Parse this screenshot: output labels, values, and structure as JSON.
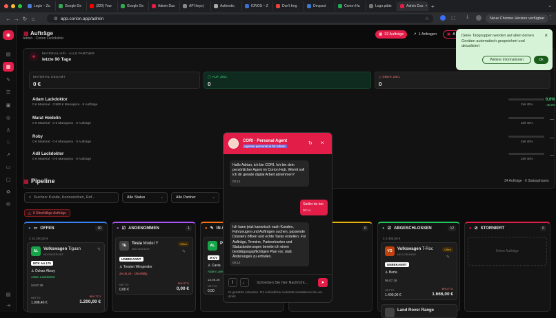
{
  "browser": {
    "tabs": [
      {
        "label": "Login – Zu",
        "color": "#4a7bd6"
      },
      {
        "label": "Google Ge",
        "color": "#34a853"
      },
      {
        "label": "(320) Your",
        "color": "#ff0000"
      },
      {
        "label": "Google Ge",
        "color": "#34a853"
      },
      {
        "label": "Admin Das",
        "color": "#e11d48"
      },
      {
        "label": "API keys |",
        "color": "#888888"
      },
      {
        "label": "Authentic",
        "color": "#aaaaaa"
      },
      {
        "label": "IONOS – Z",
        "color": "#3d6fd6"
      },
      {
        "label": "Don't forg",
        "color": "#ea4335"
      },
      {
        "label": "Devpost",
        "color": "#3a7bd5"
      },
      {
        "label": "Corion Hu",
        "color": "#22aa55"
      },
      {
        "label": "Logo pätte",
        "color": "#777777"
      },
      {
        "label": "Admin Das",
        "color": "#e11d48"
      }
    ],
    "url": "app.corion.app/admin",
    "chrome_update": "Neue Chrome-Version verfügbar"
  },
  "header": {
    "title": "Aufträge",
    "subtitle": "Admin · Corion Lackdoktor",
    "orders_pill": "32 Aufträge",
    "requests_pill": "1 Anfragen",
    "add_label": "A"
  },
  "kpi": {
    "title": "MATERIAL-KPI · ALLE PARTNER",
    "period": "letzte 90 Tage",
    "total_label": "MATERIAL GESAMT",
    "total_value": "0 €",
    "target_label": "AUF ZIEL",
    "target_value": "0",
    "over_label": "ÜBER ZIEL",
    "over_value": "0",
    "partners": [
      {
        "name": "Adam Lackdoktor",
        "detail": "0 € Material · 3.580 € Manopera · 8 Aufträge",
        "goal": "Ziel 40%",
        "pct": "0,0%",
        "delta": "-40,0%"
      },
      {
        "name": "Marat Heidelin",
        "detail": "0 € Material · 0 € Manopera · 0 Aufträge",
        "goal": "Ziel 40%",
        "pct": "—",
        "delta": ""
      },
      {
        "name": "Roby",
        "detail": "0 € Material · 0 € Manopera · 0 Aufträge",
        "goal": "Ziel 40%",
        "pct": "—",
        "delta": ""
      },
      {
        "name": "Adil Lackdoktor",
        "detail": "0 € Material · 0 € Manopera · 0 Aufträge",
        "goal": "Ziel 40%",
        "pct": "—",
        "delta": ""
      }
    ]
  },
  "pipeline": {
    "title": "Pipeline",
    "summary": "34 Aufträge · 6 Statusphasen",
    "search_placeholder": "Suchen: Kunde, Kennzeichen, Ref...",
    "status_filter": "Alle Status",
    "partner_filter": "Alle Partner",
    "overdue": "9 Überfällige Aufträge",
    "columns": [
      {
        "name": "OFFEN",
        "count": "30",
        "color": "#3b82f6"
      },
      {
        "name": "ANGENOMMEN",
        "count": "1",
        "color": "#a855f7"
      },
      {
        "name": "IN A",
        "count": "",
        "color": "#f97316"
      },
      {
        "name": "",
        "count": "0",
        "color": "#eab308"
      },
      {
        "name": "ABGESCHLOSSEN",
        "count": "12",
        "color": "#22c55e"
      },
      {
        "name": "STORNIERT",
        "count": "0",
        "color": "#e11d48"
      }
    ],
    "cards": {
      "offen": {
        "sum": "Σ 10.300,00 €",
        "initials": "AL",
        "brand": "Volkswagen",
        "model": "Tiguan",
        "ref": "NO-FACEPLIST",
        "plate": "MTK AA 175",
        "customer": "Özkan Aksoy",
        "partner": "Adam Lackdoktor",
        "date": "24.07.26",
        "netto_label": "NETTO",
        "netto": "1.008,40 €",
        "brutto_label": "BRUTTO",
        "brutto": "1.200,00 €"
      },
      "angenommen": {
        "initials": "TE",
        "brand": "Tesla",
        "model": "Model Y",
        "ref": "NO-FACELIST",
        "status": "Offen",
        "plate": "UNBEKANNT",
        "customer": "Torsten Wingender",
        "date": "26.06.26 · Überfällig",
        "netto_label": "NETTO",
        "netto": "0,00 €",
        "brutto_label": "BRUTTO",
        "brutto": "0,00 €"
      },
      "inarbeit": {
        "initials": "AL",
        "brand": "P",
        "plate": "M CV",
        "customer": "Cavia",
        "partner": "Adam Lackd",
        "date": "13.06.26",
        "netto_label": "NETTO",
        "netto": "0,00"
      },
      "abgeschlossen": {
        "sum": "Σ 4.300,00 €",
        "initials": "VO",
        "brand": "Volkswagen",
        "model": "T-Roc",
        "ref": "NO-LOSUNGS",
        "status": "Offen",
        "plate": "UNBEKANNT",
        "customer": "Berta",
        "date": "06.07.26",
        "netto_label": "NETTO",
        "netto": "1.400,00 €",
        "brutto_label": "BRUTTO",
        "brutto": "1.666,00 €",
        "next": "Land Rover Range"
      },
      "storniert": {
        "empty": "Keine Aufträge"
      }
    }
  },
  "chat": {
    "title": "CORI · Personal Agent",
    "subtitle": "Agentur personal ai für Adrian",
    "messages": [
      {
        "from": "bot",
        "text": "Hallo Adrian, ich bin CORI. Ich bin dein persönlicher Agent im Corion Hub. Womit soll ich dir gerade digital Arbeit abnehmen?",
        "time": "00:14"
      },
      {
        "from": "user",
        "text": "Stellst du bei",
        "time": "00:14"
      },
      {
        "from": "bot",
        "text": "Ich kann jetzt kanonisch nach Kunden, Fahrzeugen und Aufträgen suchen, passende Dossiers öffnen und echte Tasks erstellen. Für Aufträge, Termine, Partnerkonten und Statusänderungen bereite ich einen bestätigungspflichtigen Plan vor, statt Änderungen zu erfinden.",
        "time": "00:14"
      }
    ],
    "input_placeholder": "Schreiben Sie hier Nachricht...",
    "disclaimer": "KI-gestützte Antworten. Für verbindliche Auskünfte kontaktieren Sie uns direkt."
  },
  "notification": {
    "text": "Deine Tabgruppen werden auf allen deinen Geräten automatisch gespeichert und aktualisiert",
    "more": "Weitere Informationen",
    "ok": "Ok"
  }
}
